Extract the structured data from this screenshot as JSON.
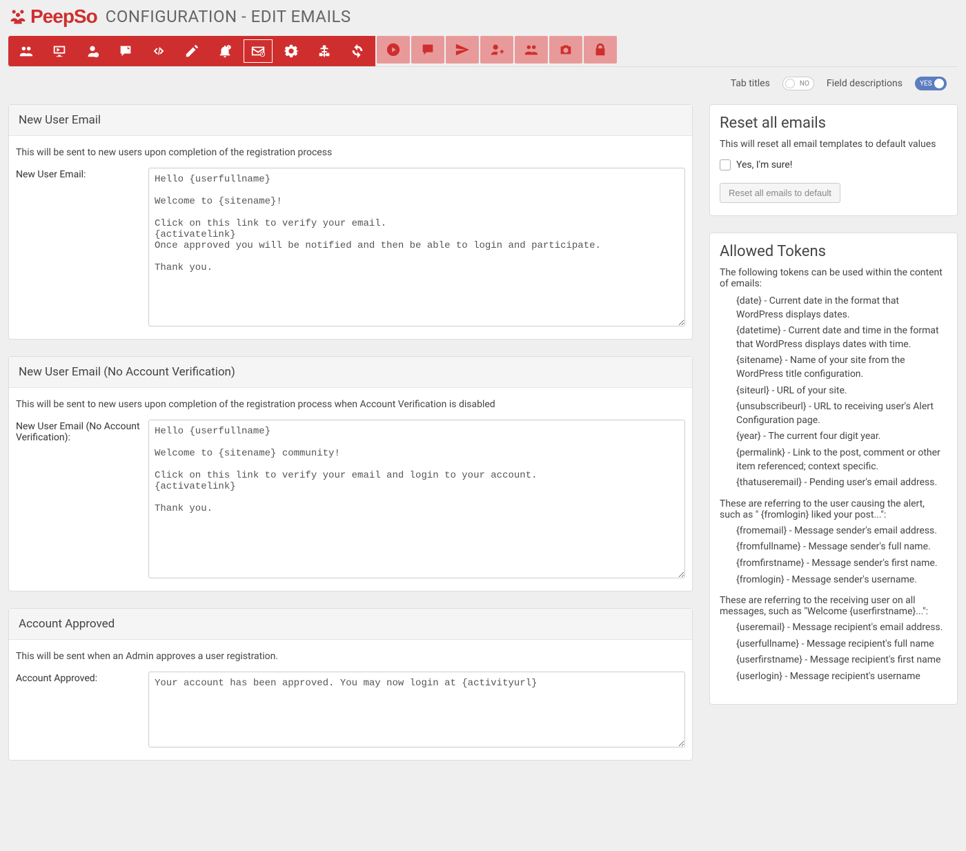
{
  "header": {
    "brand": "PeepSo",
    "title": "CONFIGURATION - EDIT EMAILS"
  },
  "tabs": [
    {
      "name": "users",
      "primary": true
    },
    {
      "name": "display",
      "primary": true
    },
    {
      "name": "profile",
      "primary": true
    },
    {
      "name": "comment",
      "primary": true
    },
    {
      "name": "code",
      "primary": true
    },
    {
      "name": "edit",
      "primary": true
    },
    {
      "name": "alert",
      "primary": true
    },
    {
      "name": "email",
      "primary": true,
      "active": true
    },
    {
      "name": "settings",
      "primary": true
    },
    {
      "name": "flow",
      "primary": true
    },
    {
      "name": "sync",
      "primary": true
    },
    {
      "name": "video",
      "primary": false
    },
    {
      "name": "chat",
      "primary": false
    },
    {
      "name": "send",
      "primary": false
    },
    {
      "name": "adduser",
      "primary": false
    },
    {
      "name": "group",
      "primary": false
    },
    {
      "name": "camera",
      "primary": false
    },
    {
      "name": "lock",
      "primary": false
    }
  ],
  "toggles": {
    "tab_titles": {
      "label": "Tab titles",
      "state": "off",
      "text": "NO"
    },
    "field_descriptions": {
      "label": "Field descriptions",
      "state": "on",
      "text": "YES"
    }
  },
  "sections": [
    {
      "id": "new_user",
      "title": "New User Email",
      "desc": "This will be sent to new users upon completion of the registration process",
      "field_label": "New User Email:",
      "value": "Hello {userfullname}\n\nWelcome to {sitename}!\n\nClick on this link to verify your email.\n{activatelink}\nOnce approved you will be notified and then be able to login and participate.\n\nThank you."
    },
    {
      "id": "new_user_no_verify",
      "title": "New User Email (No Account Verification)",
      "desc": "This will be sent to new users upon completion of the registration process when Account Verification is disabled",
      "field_label": "New User Email (No Account Verification):",
      "value": "Hello {userfullname}\n\nWelcome to {sitename} community!\n\nClick on this link to verify your email and login to your account.\n{activatelink}\n\nThank you."
    },
    {
      "id": "account_approved",
      "title": "Account Approved",
      "desc": "This will be sent when an Admin approves a user registration.",
      "field_label": "Account Approved:",
      "value": "Your account has been approved. You may now login at {activityurl}"
    }
  ],
  "reset": {
    "title": "Reset all emails",
    "desc": "This will reset all email templates to default values",
    "checkbox_label": "Yes, I'm sure!",
    "button": "Reset all emails to default"
  },
  "tokens": {
    "title": "Allowed Tokens",
    "intro": "The following tokens can be used within the content of emails:",
    "list1": [
      "{date} - Current date in the format that WordPress displays dates.",
      "{datetime} - Current date and time in the format that WordPress displays dates with time.",
      "{sitename} - Name of your site from the WordPress title configuration.",
      "{siteurl} - URL of your site.",
      "{unsubscribeurl} - URL to receiving user's Alert Configuration page.",
      "{year} - The current four digit year.",
      "{permalink} - Link to the post, comment or other item referenced; context specific.",
      "{thatuseremail} - Pending user's email address."
    ],
    "sub2": "These are referring to the user causing the alert, such as \" {fromlogin} liked your post...\":",
    "list2": [
      "{fromemail} - Message sender's email address.",
      "{fromfullname} - Message sender's full name.",
      "{fromfirstname} - Message sender's first name.",
      "{fromlogin} - Message sender's username."
    ],
    "sub3": "These are referring to the receiving user on all messages, such as \"Welcome {userfirstname}...\":",
    "list3": [
      "{useremail} - Message recipient's email address.",
      "{userfullname} - Message recipient's full name",
      "{userfirstname} - Message recipient's first name",
      "{userlogin} - Message recipient's username"
    ]
  }
}
